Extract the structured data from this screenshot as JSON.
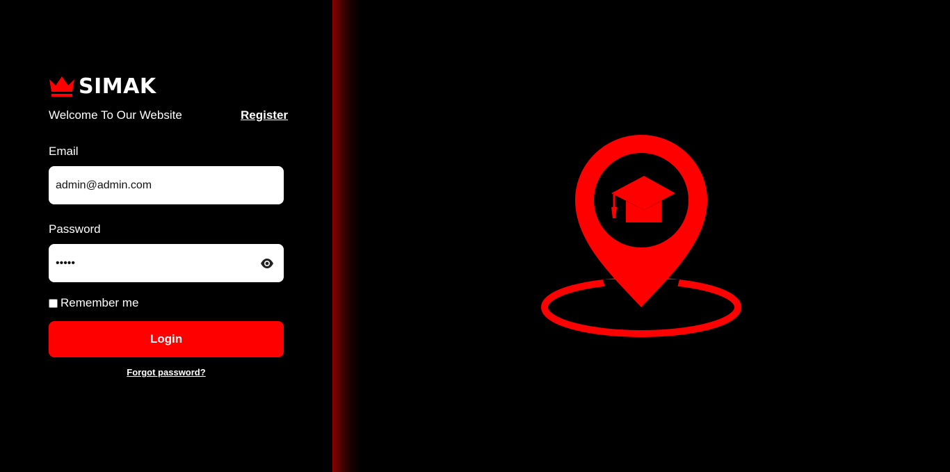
{
  "brand": {
    "name": "SIMAK",
    "icon": "crown-icon",
    "accent_color": "#ff0000"
  },
  "header": {
    "welcome_text": "Welcome To Our Website",
    "register_label": "Register"
  },
  "form": {
    "email_label": "Email",
    "email_value": "admin@admin.com",
    "password_label": "Password",
    "password_value": "•••••",
    "password_toggle_icon": "eye-icon",
    "remember_label": "Remember me",
    "remember_checked": false,
    "login_label": "Login",
    "forgot_label": "Forgot password?"
  },
  "hero": {
    "icon": "location-pin-graduation-cap-icon",
    "color": "#ff0000"
  },
  "colors": {
    "background": "#000000",
    "primary": "#ff0000",
    "input_background": "#ffffff"
  }
}
